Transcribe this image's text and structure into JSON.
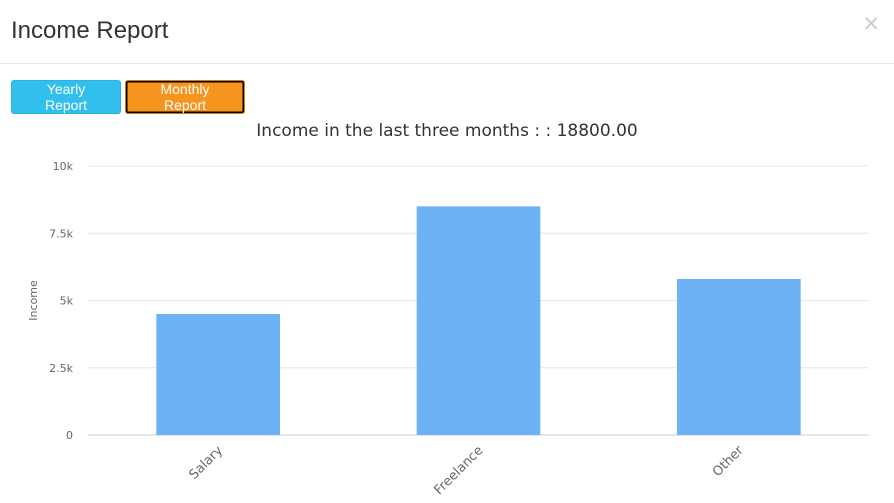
{
  "modal": {
    "title": "Income Report",
    "close_label": "×"
  },
  "buttons": {
    "yearly_label": "Yearly Report",
    "monthly_label": "Monthly Report"
  },
  "colors": {
    "bar": "#6cb2f4",
    "yearly_button": "#31c0ee",
    "monthly_button": "#f7941d",
    "grid": "#e6e6e6"
  },
  "chart_data": {
    "type": "bar",
    "title": "Income in the last three months : : 18800.00",
    "categories": [
      "Salary",
      "Freelance",
      "Other"
    ],
    "values": [
      4500,
      8500,
      5800
    ],
    "ylabel": "Income",
    "xlabel": "",
    "ylim": [
      0,
      10000
    ],
    "yticks": [
      "0",
      "2.5k",
      "5k",
      "7.5k",
      "10k"
    ],
    "grid": true,
    "legend": "none"
  }
}
